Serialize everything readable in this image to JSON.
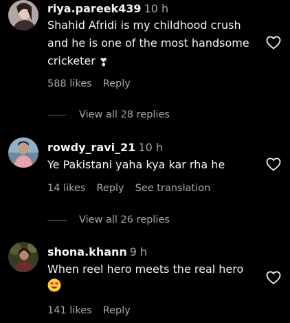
{
  "comments": [
    {
      "username": "riya.pareek439",
      "time": "10 h",
      "text": "Shahid Afridi is my childhood crush and he is one of the most handsome cricketer",
      "emoji": "❣",
      "likes": "588 likes",
      "reply_label": "Reply",
      "view_replies": "View all 28 replies",
      "avatar_icon": "avatar-photo-riya"
    },
    {
      "username": "rowdy_ravi_21",
      "time": "10 h",
      "text": "Ye Pakistani yaha kya kar rha he",
      "likes": "14 likes",
      "reply_label": "Reply",
      "see_translation": "See translation",
      "view_replies": "View all 26 replies",
      "avatar_icon": "avatar-photo-ravi"
    },
    {
      "username": "shona.khann",
      "time": "9 h",
      "text": "When reel hero meets the real hero",
      "emoji": "😍",
      "likes": "141 likes",
      "reply_label": "Reply",
      "avatar_icon": "avatar-photo-shona"
    }
  ],
  "icons": {
    "like": "heart-outline-icon"
  },
  "colors": {
    "background": "#000000",
    "primary_text": "#f5f5f5",
    "secondary_text": "#a8a8a8",
    "divider": "#5a5a5a"
  }
}
